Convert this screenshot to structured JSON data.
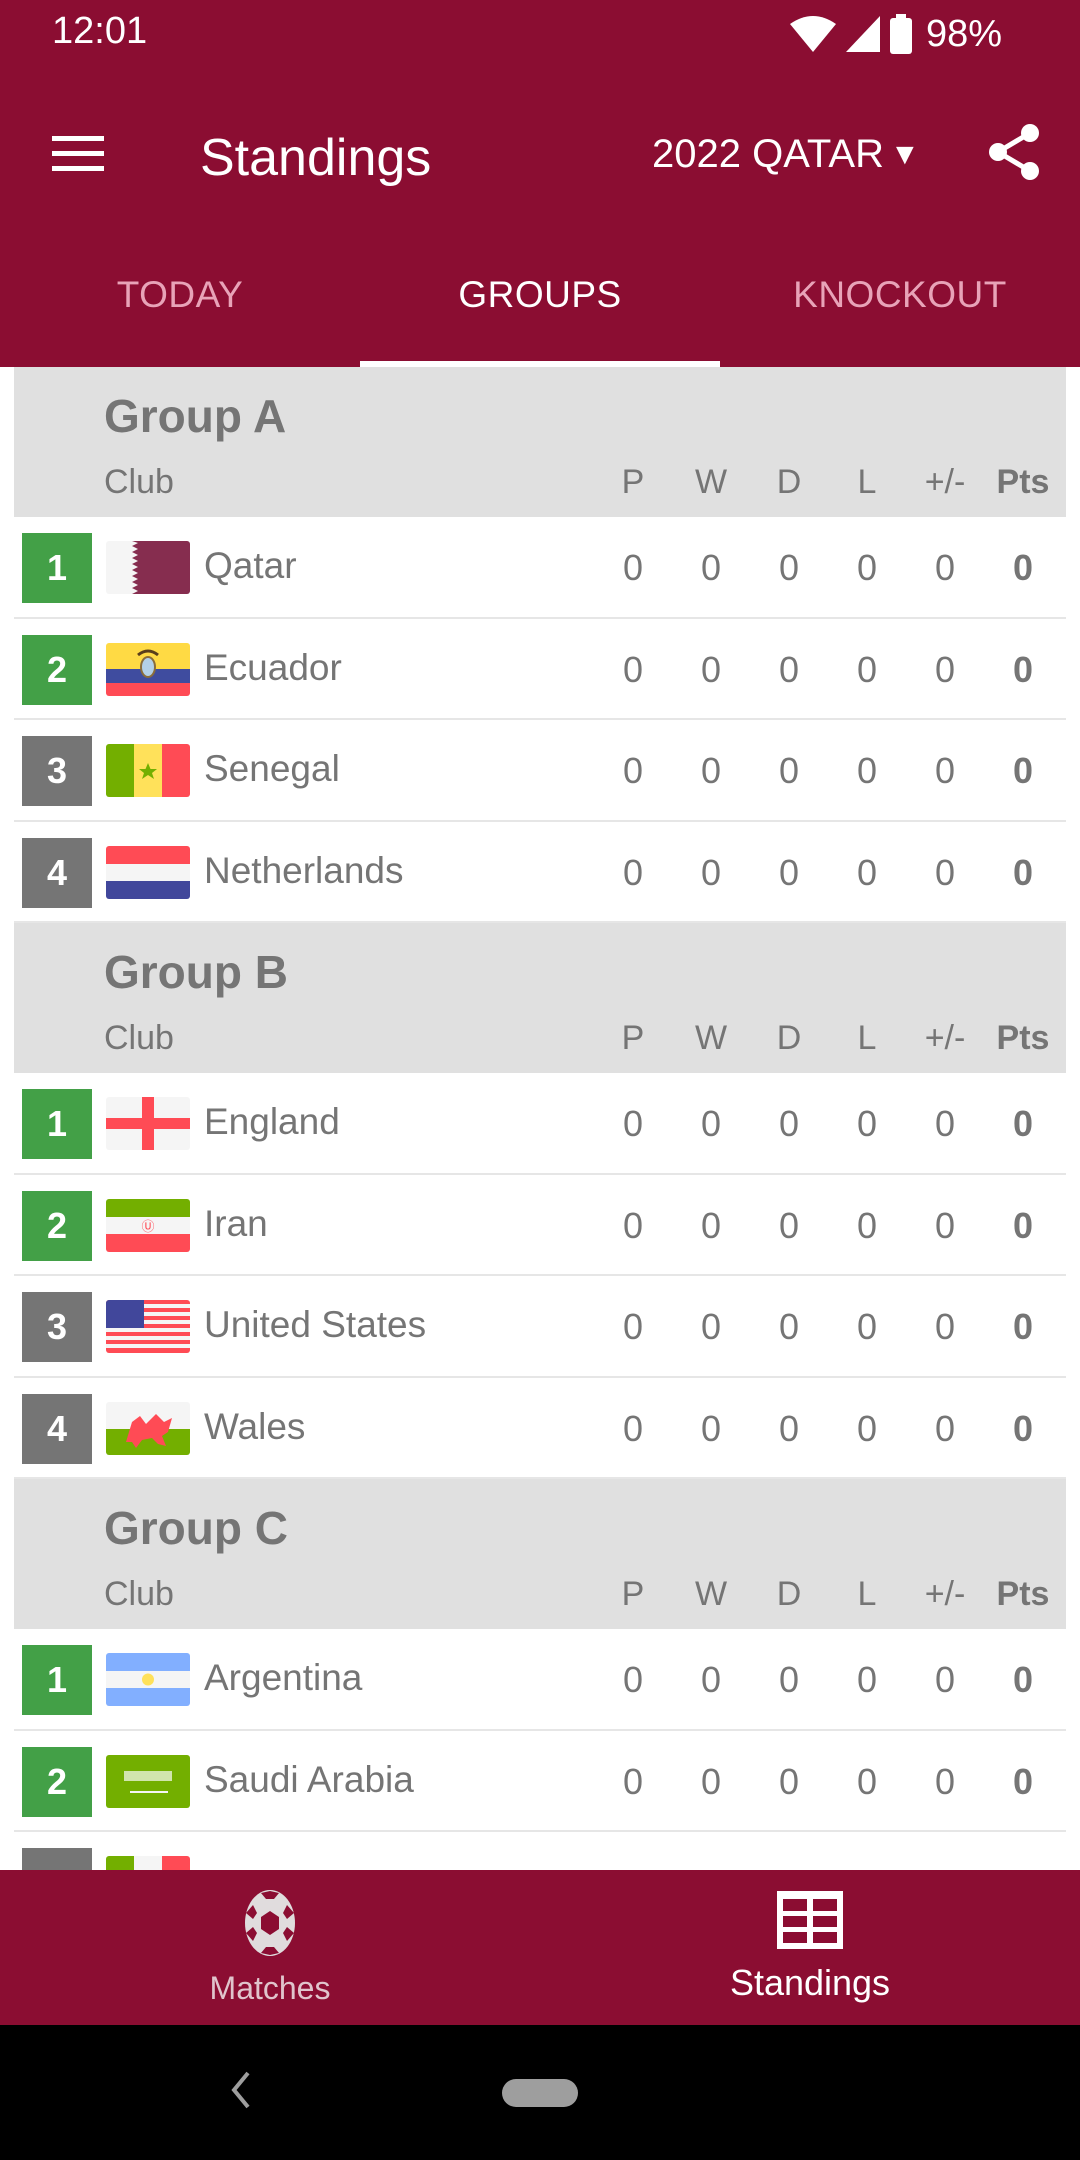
{
  "status_bar": {
    "time": "12:01",
    "battery": "98%",
    "icons": [
      "wifi-icon",
      "cell-signal-icon",
      "battery-icon"
    ]
  },
  "app_bar": {
    "title": "Standings",
    "season": "2022 QATAR",
    "menu_icon": "hamburger-menu-icon",
    "share_icon": "share-icon"
  },
  "tabs": [
    {
      "label": "TODAY",
      "active": false
    },
    {
      "label": "GROUPS",
      "active": true
    },
    {
      "label": "KNOCKOUT",
      "active": false
    }
  ],
  "columns": {
    "club": "Club",
    "p": "P",
    "w": "W",
    "d": "D",
    "l": "L",
    "gd": "+/-",
    "pts": "Pts"
  },
  "colors": {
    "brand": "#8b0d32",
    "qualify": "#43a047",
    "non_qualify": "#757575",
    "header_bg": "#e0e0e0"
  },
  "groups": [
    {
      "name": "Group A",
      "teams": [
        {
          "rank": "1",
          "name": "Qatar",
          "flag": "qatar-flag-icon",
          "p": "0",
          "w": "0",
          "d": "0",
          "l": "0",
          "gd": "0",
          "pts": "0",
          "qualify": true
        },
        {
          "rank": "2",
          "name": "Ecuador",
          "flag": "ecuador-flag-icon",
          "p": "0",
          "w": "0",
          "d": "0",
          "l": "0",
          "gd": "0",
          "pts": "0",
          "qualify": true
        },
        {
          "rank": "3",
          "name": "Senegal",
          "flag": "senegal-flag-icon",
          "p": "0",
          "w": "0",
          "d": "0",
          "l": "0",
          "gd": "0",
          "pts": "0",
          "qualify": false
        },
        {
          "rank": "4",
          "name": "Netherlands",
          "flag": "netherlands-flag-icon",
          "p": "0",
          "w": "0",
          "d": "0",
          "l": "0",
          "gd": "0",
          "pts": "0",
          "qualify": false
        }
      ]
    },
    {
      "name": "Group B",
      "teams": [
        {
          "rank": "1",
          "name": "England",
          "flag": "england-flag-icon",
          "p": "0",
          "w": "0",
          "d": "0",
          "l": "0",
          "gd": "0",
          "pts": "0",
          "qualify": true
        },
        {
          "rank": "2",
          "name": "Iran",
          "flag": "iran-flag-icon",
          "p": "0",
          "w": "0",
          "d": "0",
          "l": "0",
          "gd": "0",
          "pts": "0",
          "qualify": true
        },
        {
          "rank": "3",
          "name": "United States",
          "flag": "usa-flag-icon",
          "p": "0",
          "w": "0",
          "d": "0",
          "l": "0",
          "gd": "0",
          "pts": "0",
          "qualify": false
        },
        {
          "rank": "4",
          "name": "Wales",
          "flag": "wales-flag-icon",
          "p": "0",
          "w": "0",
          "d": "0",
          "l": "0",
          "gd": "0",
          "pts": "0",
          "qualify": false
        }
      ]
    },
    {
      "name": "Group C",
      "teams": [
        {
          "rank": "1",
          "name": "Argentina",
          "flag": "argentina-flag-icon",
          "p": "0",
          "w": "0",
          "d": "0",
          "l": "0",
          "gd": "0",
          "pts": "0",
          "qualify": true
        },
        {
          "rank": "2",
          "name": "Saudi Arabia",
          "flag": "saudi-arabia-flag-icon",
          "p": "0",
          "w": "0",
          "d": "0",
          "l": "0",
          "gd": "0",
          "pts": "0",
          "qualify": true
        },
        {
          "rank": "",
          "name": "",
          "flag": "mexico-flag-icon",
          "p": "",
          "w": "",
          "d": "",
          "l": "",
          "gd": "",
          "pts": "",
          "qualify": false
        }
      ]
    }
  ],
  "bottom_nav": [
    {
      "label": "Matches",
      "icon": "soccer-ball-icon",
      "active": false
    },
    {
      "label": "Standings",
      "icon": "table-grid-icon",
      "active": true
    }
  ]
}
